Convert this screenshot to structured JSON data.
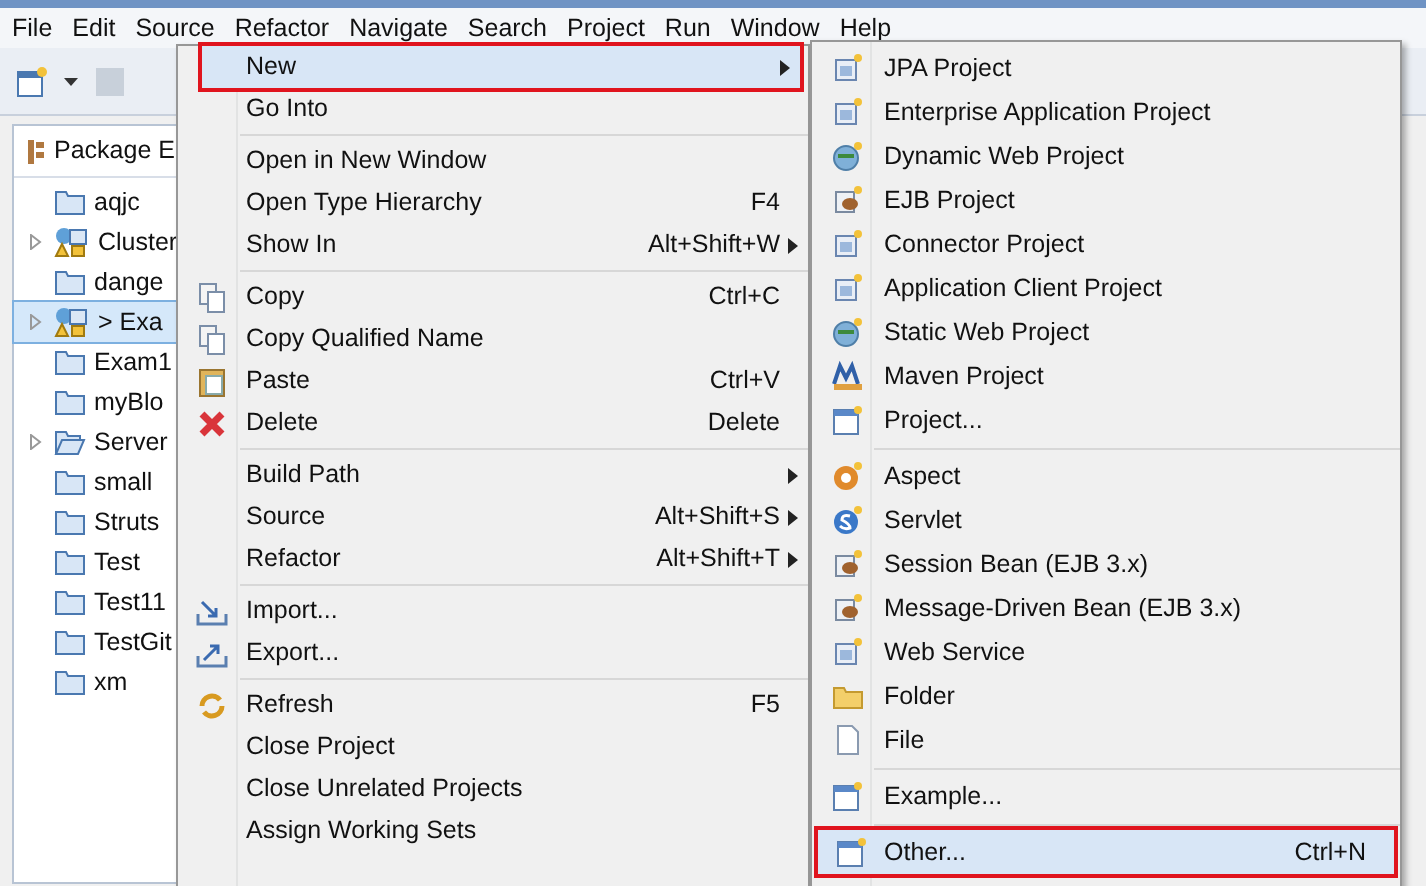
{
  "menu_bar": [
    "File",
    "Edit",
    "Source",
    "Refactor",
    "Navigate",
    "Search",
    "Project",
    "Run",
    "Window",
    "Help"
  ],
  "package_explorer": {
    "title": "Package E",
    "items": [
      {
        "label": "aqjc",
        "kind": "folder",
        "expandable": false,
        "selected": false
      },
      {
        "label": "Cluster",
        "kind": "project",
        "expandable": true,
        "selected": false
      },
      {
        "label": "dange",
        "kind": "folder",
        "expandable": false,
        "selected": false
      },
      {
        "label": "> Exa",
        "kind": "project",
        "expandable": true,
        "selected": true
      },
      {
        "label": "Exam1",
        "kind": "folder",
        "expandable": false,
        "selected": false
      },
      {
        "label": "myBlo",
        "kind": "folder",
        "expandable": false,
        "selected": false
      },
      {
        "label": "Server",
        "kind": "open-folder",
        "expandable": true,
        "selected": false
      },
      {
        "label": "small",
        "kind": "folder",
        "expandable": false,
        "selected": false
      },
      {
        "label": "Struts",
        "kind": "folder",
        "expandable": false,
        "selected": false
      },
      {
        "label": "Test",
        "kind": "folder",
        "expandable": false,
        "selected": false
      },
      {
        "label": "Test11",
        "kind": "folder",
        "expandable": false,
        "selected": false
      },
      {
        "label": "TestGit",
        "kind": "folder",
        "expandable": false,
        "selected": false
      },
      {
        "label": "xm",
        "kind": "folder",
        "expandable": false,
        "selected": false
      }
    ]
  },
  "context_menu": [
    {
      "kind": "plain",
      "label": "New",
      "submenu": true,
      "selected": true
    },
    {
      "kind": "plain",
      "label": "Go Into",
      "submenu": false,
      "selected": false
    },
    {
      "kind": "separator"
    },
    {
      "kind": "plain",
      "label": "Open in New Window",
      "submenu": false,
      "selected": false
    },
    {
      "kind": "plain",
      "label": "Open Type Hierarchy",
      "shortcut": "F4",
      "submenu": false,
      "selected": false
    },
    {
      "kind": "plain",
      "label": "Show In",
      "shortcut": "Alt+Shift+W",
      "submenu": true,
      "selected": false
    },
    {
      "kind": "separator"
    },
    {
      "kind": "copy",
      "label": "Copy",
      "shortcut": "Ctrl+C",
      "submenu": false,
      "selected": false
    },
    {
      "kind": "copy",
      "label": "Copy Qualified Name",
      "submenu": false,
      "selected": false
    },
    {
      "kind": "paste",
      "label": "Paste",
      "shortcut": "Ctrl+V",
      "submenu": false,
      "selected": false
    },
    {
      "kind": "delete",
      "label": "Delete",
      "shortcut": "Delete",
      "submenu": false,
      "selected": false
    },
    {
      "kind": "separator"
    },
    {
      "kind": "plain",
      "label": "Build Path",
      "submenu": true,
      "selected": false
    },
    {
      "kind": "plain",
      "label": "Source",
      "shortcut": "Alt+Shift+S",
      "submenu": true,
      "selected": false
    },
    {
      "kind": "plain",
      "label": "Refactor",
      "shortcut": "Alt+Shift+T",
      "submenu": true,
      "selected": false
    },
    {
      "kind": "separator"
    },
    {
      "kind": "import",
      "label": "Import...",
      "submenu": false,
      "selected": false
    },
    {
      "kind": "export",
      "label": "Export...",
      "submenu": false,
      "selected": false
    },
    {
      "kind": "separator"
    },
    {
      "kind": "refresh",
      "label": "Refresh",
      "shortcut": "F5",
      "submenu": false,
      "selected": false
    },
    {
      "kind": "plain",
      "label": "Close Project",
      "submenu": false,
      "selected": false
    },
    {
      "kind": "plain",
      "label": "Close Unrelated Projects",
      "submenu": false,
      "selected": false
    },
    {
      "kind": "plain",
      "label": "Assign Working Sets",
      "submenu": false,
      "selected": false
    }
  ],
  "new_submenu": [
    {
      "kind": "project",
      "label": "JPA Project",
      "selected": false
    },
    {
      "kind": "project",
      "label": "Enterprise Application Project",
      "selected": false
    },
    {
      "kind": "globe",
      "label": "Dynamic Web Project",
      "selected": false
    },
    {
      "kind": "bean",
      "label": "EJB Project",
      "selected": false
    },
    {
      "kind": "project",
      "label": "Connector Project",
      "selected": false
    },
    {
      "kind": "project",
      "label": "Application Client Project",
      "selected": false
    },
    {
      "kind": "globe",
      "label": "Static Web Project",
      "selected": false
    },
    {
      "kind": "maven",
      "label": "Maven Project",
      "selected": false
    },
    {
      "kind": "window",
      "label": "Project...",
      "selected": false
    },
    {
      "kind": "separator"
    },
    {
      "kind": "aspect",
      "label": "Aspect",
      "selected": false
    },
    {
      "kind": "servlet",
      "label": "Servlet",
      "selected": false
    },
    {
      "kind": "bean",
      "label": "Session Bean (EJB 3.x)",
      "selected": false
    },
    {
      "kind": "bean",
      "label": "Message-Driven Bean (EJB 3.x)",
      "selected": false
    },
    {
      "kind": "project",
      "label": "Web Service",
      "selected": false
    },
    {
      "kind": "folder",
      "label": "Folder",
      "selected": false
    },
    {
      "kind": "file",
      "label": "File",
      "selected": false
    },
    {
      "kind": "separator"
    },
    {
      "kind": "window",
      "label": "Example...",
      "selected": false
    },
    {
      "kind": "separator"
    },
    {
      "kind": "window",
      "label": "Other...",
      "shortcut": "Ctrl+N",
      "selected": true
    }
  ]
}
